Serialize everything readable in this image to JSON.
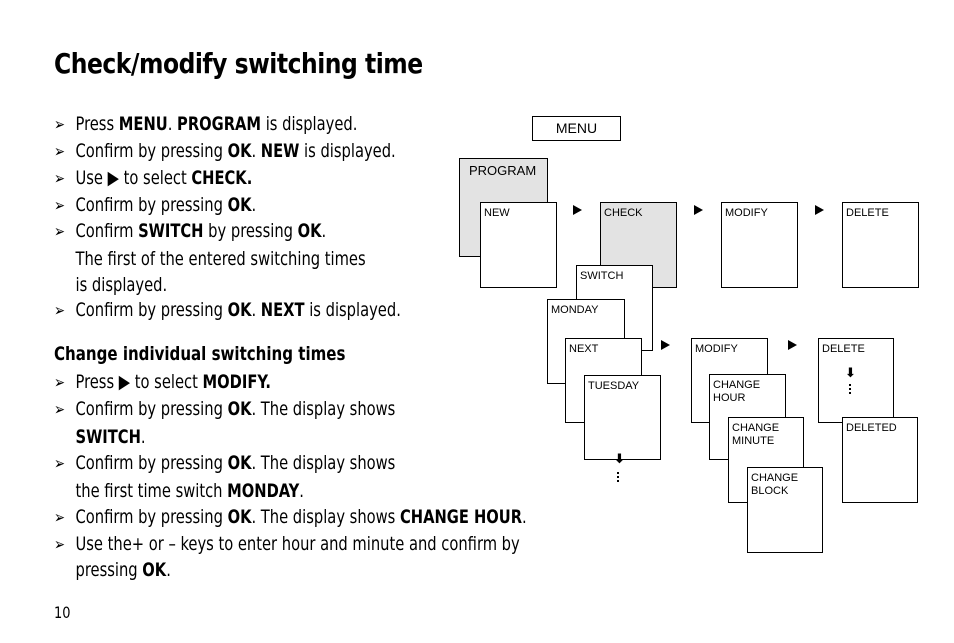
{
  "title": "Check/modify switching time",
  "bullet": "➢",
  "steps": [
    {
      "a": "Press ",
      "b": "MENU",
      "c": ". ",
      "d": "PROGRAM",
      "e": " is displayed."
    },
    {
      "a": "Confirm by pressing ",
      "b": "OK",
      "c": ". ",
      "d": "NEW",
      "e": " is displayed."
    },
    {
      "a": "Use ▶ to select ",
      "b": "CHECK."
    },
    {
      "a": "Confirm by pressing ",
      "b": "OK",
      "c": "."
    },
    {
      "a": "Confirm ",
      "b": "SWITCH",
      "c": " by pressing ",
      "d": "OK",
      "e": ".",
      "line2": "The first of the entered switching times",
      "line3": "is displayed."
    },
    {
      "a": "Confirm by pressing ",
      "b": "OK",
      "c": ". ",
      "d": "NEXT",
      "e": " is displayed."
    }
  ],
  "subheading": "Change individual switching times",
  "steps2": [
    {
      "a": "Press ▶ to select ",
      "b": "MODIFY."
    },
    {
      "a": "Confirm by pressing ",
      "b": "OK",
      "c": ". The display shows",
      "line2b": "SWITCH",
      "line2c": "."
    },
    {
      "a": "Confirm by pressing ",
      "b": "OK",
      "c": ". The display shows",
      "line2a": "the first time switch ",
      "line2b": "MONDAY",
      "line2c": "."
    },
    {
      "a": "Confirm by pressing ",
      "b": "OK",
      "c": ". The display shows ",
      "d": "CHANGE HOUR",
      "e": "."
    },
    {
      "a": "Use the+ or – keys to enter hour and minute and confirm by",
      "line2a": "pressing ",
      "line2b": "OK",
      "line2c": "."
    }
  ],
  "page_number": "10",
  "diagram": {
    "menu": "MENU",
    "program": "PROGRAM",
    "new": "NEW",
    "check": "CHECK",
    "modify_top": "MODIFY",
    "delete_top": "DELETE",
    "switch": "SWITCH",
    "monday": "MONDAY",
    "next": "NEXT",
    "tuesday": "TUESDAY",
    "modify": "MODIFY",
    "change_hour_1": "CHANGE",
    "change_hour_2": "HOUR",
    "change_minute_1": "CHANGE",
    "change_minute_2": "MINUTE",
    "change_block_1": "CHANGE",
    "change_block_2": "BLOCK",
    "delete": "DELETE",
    "deleted": "DELETED",
    "down_arrow": "⬇",
    "highlight_color": "#e3e3e3"
  }
}
